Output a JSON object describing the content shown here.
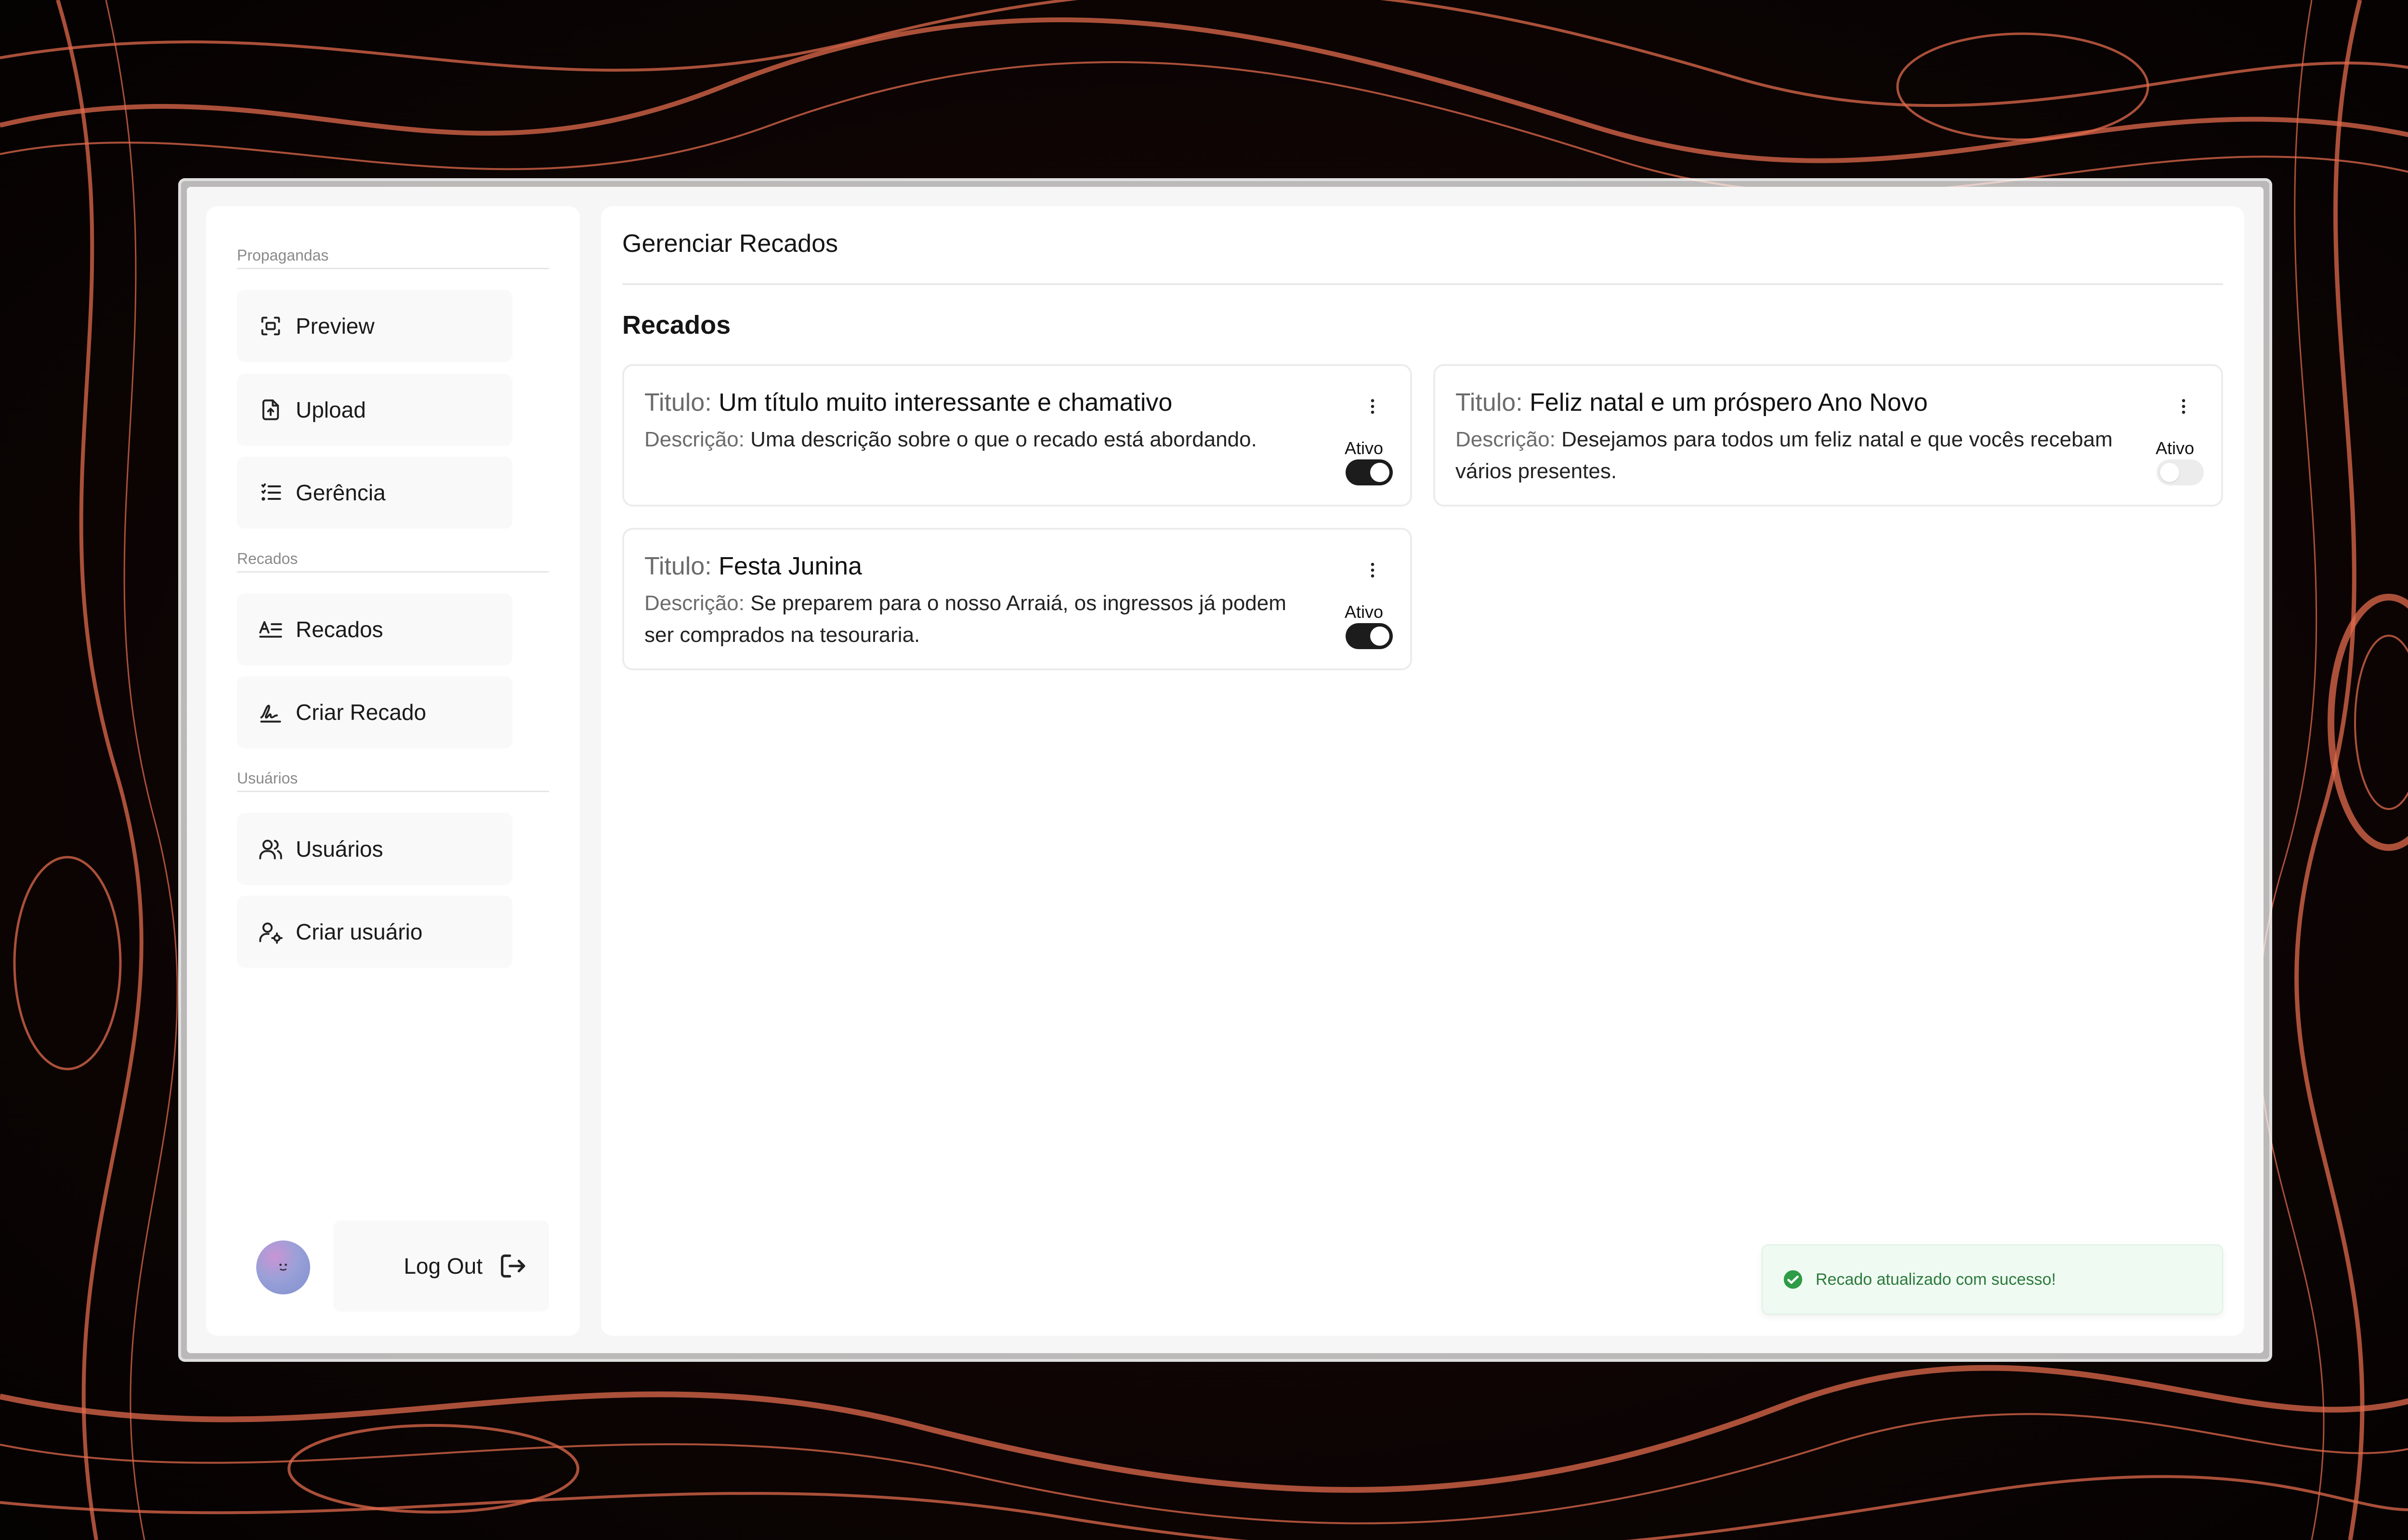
{
  "sidebar": {
    "sections": [
      {
        "label": "Propagandas",
        "items": [
          {
            "label": "Preview",
            "icon": "preview-icon"
          },
          {
            "label": "Upload",
            "icon": "upload-icon"
          },
          {
            "label": "Gerência",
            "icon": "list-icon"
          }
        ]
      },
      {
        "label": "Recados",
        "items": [
          {
            "label": "Recados",
            "icon": "text-icon"
          },
          {
            "label": "Criar Recado",
            "icon": "signature-icon"
          }
        ]
      },
      {
        "label": "Usuários",
        "items": [
          {
            "label": "Usuários",
            "icon": "users-icon"
          },
          {
            "label": "Criar usuário",
            "icon": "user-settings-icon"
          }
        ]
      }
    ],
    "logout_label": "Log Out"
  },
  "main": {
    "page_title": "Gerenciar Recados",
    "section_title": "Recados",
    "title_prefix": "Titulo:",
    "desc_prefix": "Descrição:",
    "cards": [
      {
        "title": "Um título muito interessante e chamativo",
        "description": "Uma descrição sobre o que o recado está abordando.",
        "status_label": "Ativo",
        "active": true
      },
      {
        "title": "Feliz natal e um próspero Ano Novo",
        "description": "Desejamos para todos um feliz natal e que vocês recebam vários presentes.",
        "status_label": "Ativo",
        "active": false
      },
      {
        "title": "Festa Junina",
        "description": "Se preparem para o nosso Arraiá, os ingressos já podem ser comprados na tesouraria.",
        "status_label": "Ativo",
        "active": true
      }
    ]
  },
  "toast": {
    "message": "Recado atualizado com sucesso!",
    "icon": "check-circle-icon",
    "color": "#2e9b47"
  },
  "colors": {
    "accent": "#e06a4e",
    "toggle_on": "#1c1c1c",
    "toggle_off": "#ececec"
  }
}
